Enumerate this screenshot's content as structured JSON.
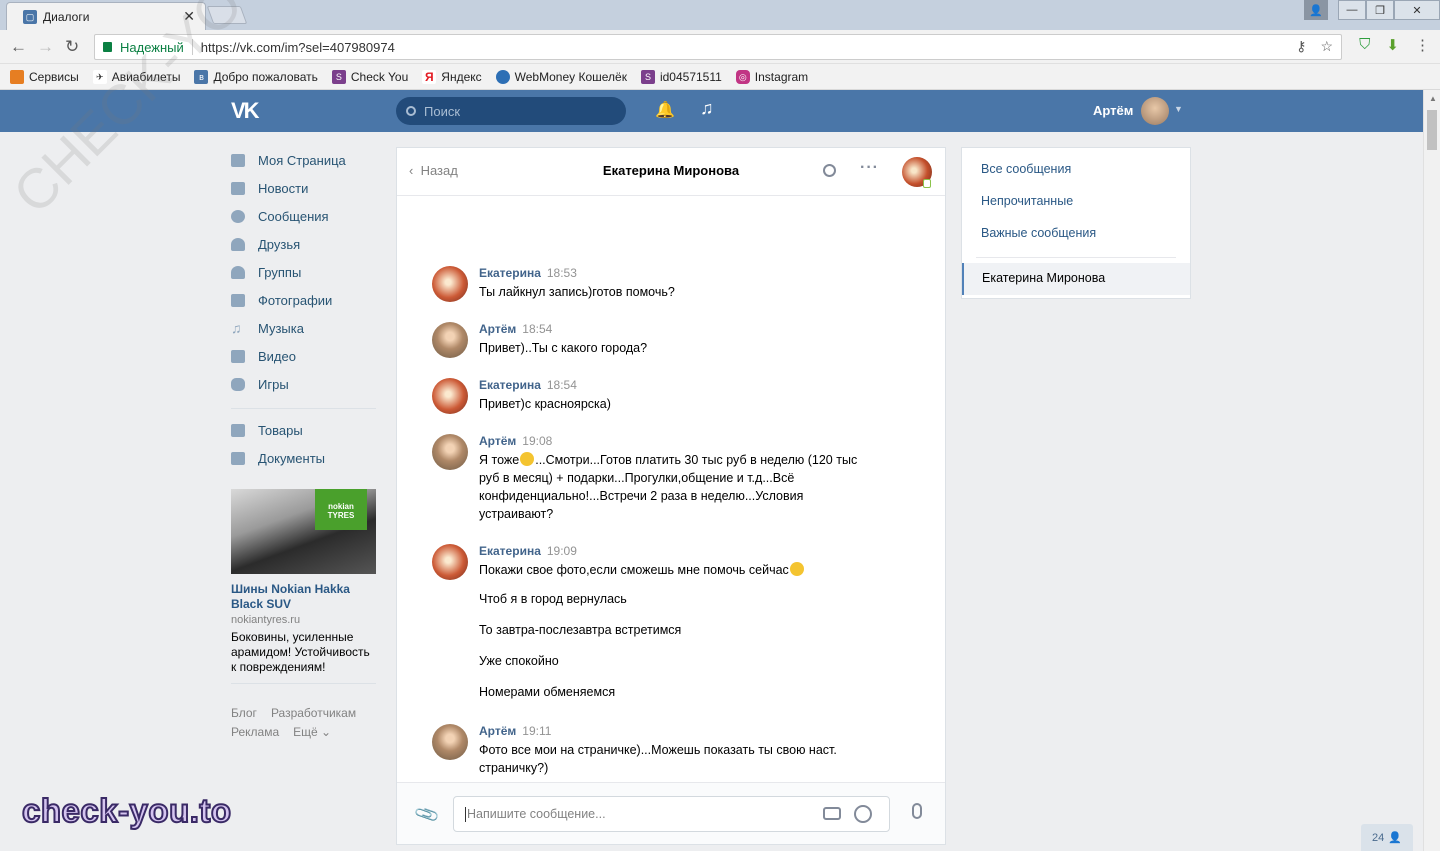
{
  "browser": {
    "tab_title": "Диалоги",
    "tab_close": "✕",
    "secure_label": "Надежный",
    "url": "https://vk.com/im?sel=407980974",
    "bookmarks": [
      {
        "label": "Сервисы",
        "color": "#e67e22"
      },
      {
        "label": "Авиабилеты",
        "color": "#333333"
      },
      {
        "label": "Добро пожаловать",
        "color": "#4a76a8"
      },
      {
        "label": "Check You",
        "color": "#7b3f8c"
      },
      {
        "label": "Яндекс",
        "color": "#e31b23"
      },
      {
        "label": "WebMoney Кошелёк",
        "color": "#2d6fb5"
      },
      {
        "label": "id04571511",
        "color": "#7b3f8c"
      },
      {
        "label": "Instagram",
        "color": "#c13584"
      }
    ]
  },
  "vk": {
    "search_placeholder": "Поиск",
    "user_name": "Артём",
    "menu": [
      "Моя Страница",
      "Новости",
      "Сообщения",
      "Друзья",
      "Группы",
      "Фотографии",
      "Музыка",
      "Видео",
      "Игры"
    ],
    "menu2": [
      "Товары",
      "Документы"
    ],
    "ad": {
      "logo_line1": "nokian",
      "logo_line2": "TYRES",
      "title": "Шины Nokian Hakka Black SUV",
      "domain": "nokiantyres.ru",
      "text": "Боковины, усиленные арамидом! Устойчивость к повреждениям!"
    },
    "footer": {
      "blog": "Блог",
      "dev": "Разработчикам",
      "ads": "Реклама",
      "more": "Ещё ⌄"
    }
  },
  "chat": {
    "back_label": "Назад",
    "title": "Екатерина Миронова",
    "messages": [
      {
        "author": "Екатерина",
        "time": "18:53",
        "text": "Ты лайкнул запись)готов помочь?"
      },
      {
        "author": "Артём",
        "time": "18:54",
        "text": "Привет)..Ты с какого города?"
      },
      {
        "author": "Екатерина",
        "time": "18:54",
        "text": "Привет)с красноярска)"
      },
      {
        "author": "Артём",
        "time": "19:08",
        "text_a": "Я тоже",
        "text_b": "...Смотри...Готов платить 30 тыс руб в неделю (120 тыс руб в месяц) + подарки...Прогулки,общение и т.д...Всё конфиденциально!...Встречи 2 раза в неделю...Условия устраивают?"
      },
      {
        "author": "Екатерина",
        "time": "19:09",
        "text": "Покажи свое фото,если сможешь мне помочь сейчас",
        "extra": [
          "Чтоб я в город вернулась",
          "То завтра-послезавтра встретимся",
          "Уже спокойно",
          "Номерами обменяемся"
        ]
      },
      {
        "author": "Артём",
        "time": "19:11",
        "text": "Фото все мои на страничке)...Можешь показать ты свою наст. страничку?)"
      }
    ],
    "input_placeholder": "Напишите сообщение..."
  },
  "right_panel": {
    "items": [
      "Все сообщения",
      "Непрочитанные",
      "Важные сообщения"
    ],
    "active": "Екатерина Миронова"
  },
  "watermark": {
    "diagonal": "CHECK-YOUME",
    "brand": "check-you.to"
  },
  "badge": {
    "count": "24"
  },
  "colors": {
    "vk_blue": "#4a76a8",
    "link": "#2a5885",
    "author": "#42648b"
  }
}
